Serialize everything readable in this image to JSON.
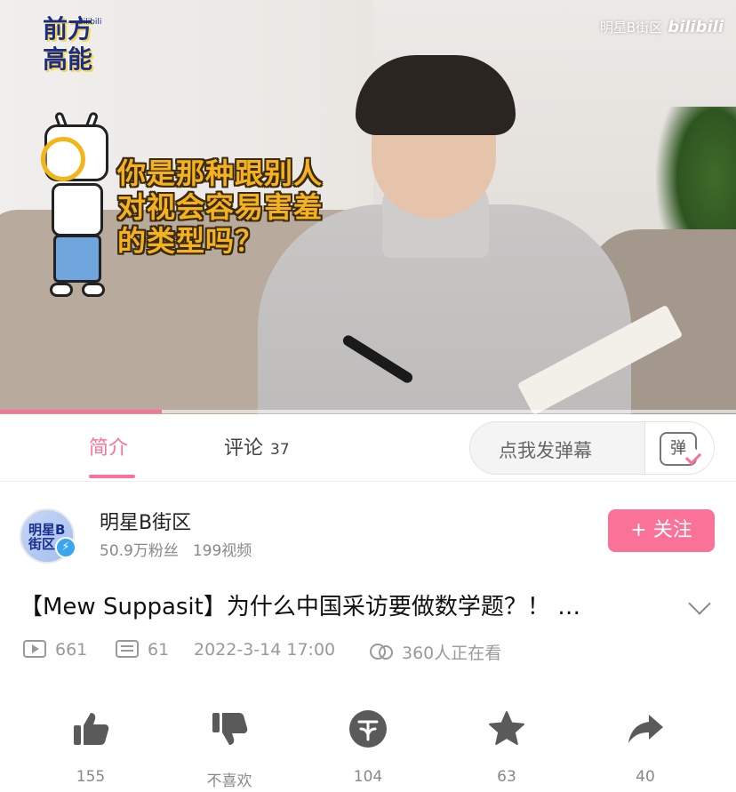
{
  "video": {
    "watermark_channel": "明星B街区",
    "watermark_brand": "bilibili",
    "logo_text_line1": "前方",
    "logo_text_line2": "高能",
    "logo_small": "bilibili",
    "caption_lines": [
      "你是那种跟别人",
      "对视会容易害羞",
      "的类型吗？"
    ],
    "progress_fraction": 0.22
  },
  "tabs": {
    "intro_label": "简介",
    "comments_label": "评论",
    "comments_count": "37",
    "danmaku_placeholder": "点我发弹幕",
    "danmaku_icon_char": "弹"
  },
  "uploader": {
    "name": "明星B街区",
    "followers": "50.9万粉丝",
    "videos": "199视频",
    "follow_label": "+ 关注",
    "avatar_text": "明星B街区"
  },
  "title": "【Mew  Suppasit】为什么中国采访要做数学题？！ …",
  "stats": {
    "plays": "661",
    "danmaku": "61",
    "date": "2022-3-14 17:00",
    "watching": "360人正在看"
  },
  "actions": [
    {
      "name": "like",
      "label": "155",
      "icon": "thumb-up-icon"
    },
    {
      "name": "dislike",
      "label": "不喜欢",
      "icon": "thumb-down-icon"
    },
    {
      "name": "coin",
      "label": "104",
      "icon": "coin-icon"
    },
    {
      "name": "favorite",
      "label": "63",
      "icon": "star-icon"
    },
    {
      "name": "share",
      "label": "40",
      "icon": "share-icon"
    }
  ],
  "colors": {
    "accent": "#fb7299",
    "icon_gray": "#5a5a5a",
    "caption_yellow": "#f5b21c"
  }
}
